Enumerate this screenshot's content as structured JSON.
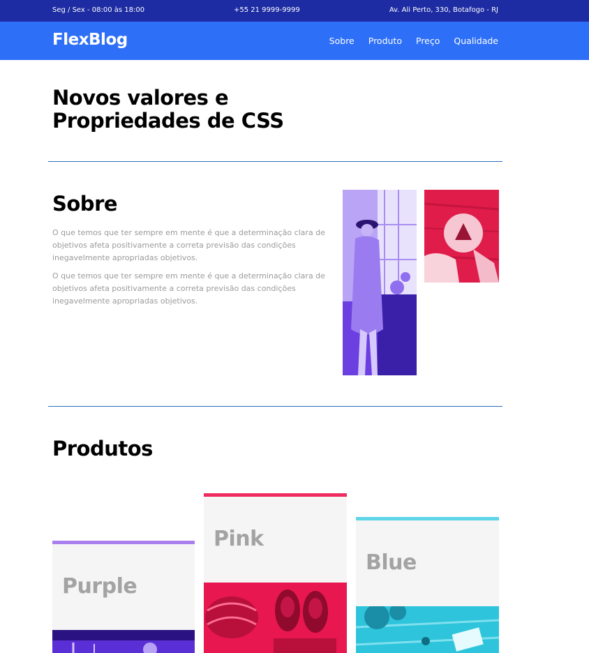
{
  "topbar": {
    "hours": "Seg / Sex - 08:00 às 18:00",
    "phone": "+55 21 9999-9999",
    "address": "Av. Ali Perto, 330, Botafogo - RJ"
  },
  "header": {
    "logo": "FlexBlog",
    "nav": [
      "Sobre",
      "Produto",
      "Preço",
      "Qualidade"
    ]
  },
  "hero": {
    "title": "Novos valores e Propriedades de CSS"
  },
  "sobre": {
    "title": "Sobre",
    "paragraphs": [
      "O que temos que ter sempre em mente é que a determinação clara de objetivos afeta positivamente a correta previsão das condições inegavelmente apropriadas objetivos.",
      "O que temos que ter sempre em mente é que a determinação clara de objetivos afeta positivamente a correta previsão das condições inegavelmente apropriadas objetivos."
    ]
  },
  "produtos": {
    "title": "Produtos",
    "cards": [
      {
        "name": "Purple",
        "color": "#a97ff0",
        "tint": "#5b2fd6"
      },
      {
        "name": "Pink",
        "color": "#ee2a5f",
        "tint": "#e8174f"
      },
      {
        "name": "Blue",
        "color": "#5fd6e8",
        "tint": "#2ec4dc"
      }
    ]
  },
  "colors": {
    "topbar": "#1e2ca3",
    "header": "#2d6ff7",
    "divider": "#2d6fbf"
  }
}
